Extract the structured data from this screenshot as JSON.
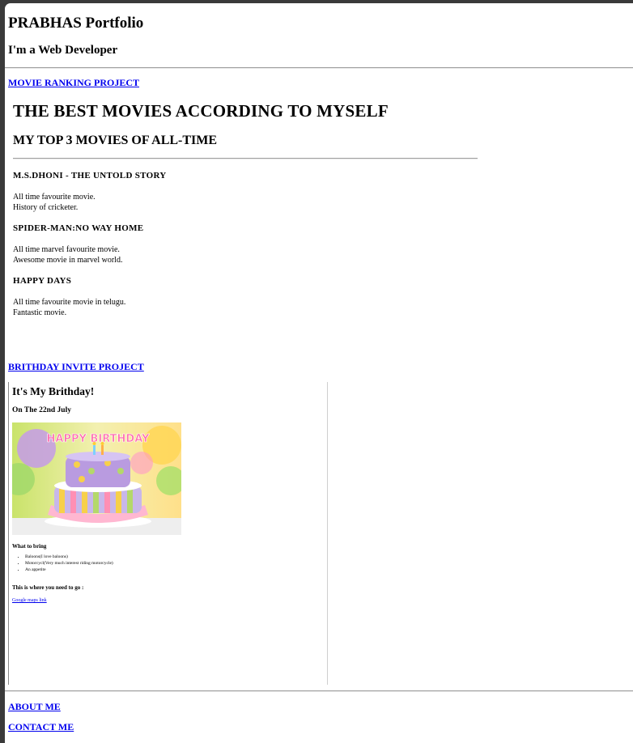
{
  "header": {
    "title": "PRABHAS Portfolio",
    "subtitle": "I'm a Web Developer"
  },
  "projects": {
    "movie_link": "MOVIE RANKING PROJECT",
    "birthday_link": "BRITHDAY INVITE PROJECT"
  },
  "movie_page": {
    "title": "THE BEST MOVIES ACCORDING TO MYSELF",
    "subtitle": "MY TOP 3 MOVIES OF ALL-TIME",
    "movies": [
      {
        "title": "M.S.DHONI - THE UNTOLD STORY",
        "line1": "All time favourite movie.",
        "line2": "History of cricketer."
      },
      {
        "title": "SPIDER-MAN:NO WAY HOME",
        "line1": "All time marvel favourite movie.",
        "line2": "Awesome movie in marvel world."
      },
      {
        "title": "HAPPY DAYS",
        "line1": "All time favourite movie in telugu.",
        "line2": "Fantastic movie."
      }
    ]
  },
  "birthday_page": {
    "title": "It's My Brithday!",
    "date": "On The 22nd July",
    "cake_sign": "HAPPY BIRTHDAY",
    "bring_heading": "What to bring",
    "bring_items": [
      "Baloons(I love baloons)",
      "Motorcycl(Very much interest riding motorcycle)",
      "An appetite"
    ],
    "where_heading": "This is where you need to go :",
    "map_link": "Google maps link"
  },
  "footer": {
    "about_link": "ABOUT ME",
    "contact_link": "CONTACT ME"
  },
  "colors": {
    "link": "#0000ee",
    "frame": "#3a3a3a"
  }
}
